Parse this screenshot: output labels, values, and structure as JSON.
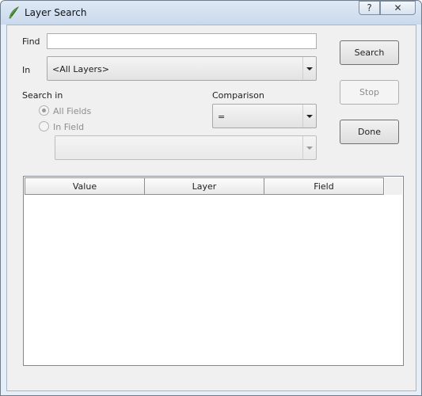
{
  "window": {
    "title": "Layer Search",
    "help_label": "?",
    "close_label": "✕"
  },
  "form": {
    "find_label": "Find",
    "find_value": "",
    "in_label": "In",
    "in_value": "<All Layers>",
    "search_in_label": "Search in",
    "all_fields_label": "All Fields",
    "all_fields_selected": true,
    "in_field_label": "In Field",
    "field_value": "",
    "comparison_label": "Comparison",
    "comparison_value": "="
  },
  "buttons": {
    "search": "Search",
    "stop": "Stop",
    "done": "Done"
  },
  "results": {
    "columns": [
      "Value",
      "Layer",
      "Field"
    ],
    "rows": []
  },
  "icons": {
    "app": "qgis-icon",
    "help": "help-icon",
    "close": "close-icon"
  }
}
